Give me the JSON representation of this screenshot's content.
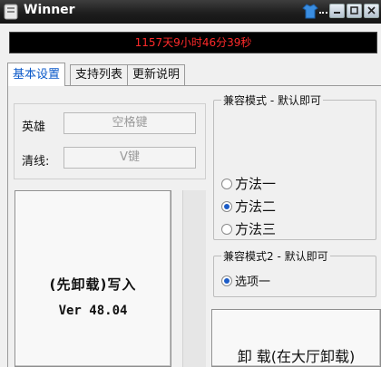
{
  "window": {
    "title": "Winner"
  },
  "timer": {
    "text": "1157天9小时46分39秒",
    "color": "#ff2a2a"
  },
  "tabs": [
    {
      "label": "基本设置",
      "active": true
    },
    {
      "label": "支持列表",
      "active": false
    },
    {
      "label": "更新说明",
      "active": false
    }
  ],
  "hotkeys": {
    "hero_label": "英雄",
    "hero_value": "空格键",
    "clear_label": "清线:",
    "clear_value": "V键"
  },
  "inject_button": {
    "line1": "(先卸载)写入",
    "line2": "Ver 48.04"
  },
  "compat1": {
    "title": "兼容模式 - 默认即可",
    "options": [
      {
        "label": "方法一",
        "selected": false
      },
      {
        "label": "方法二",
        "selected": true
      },
      {
        "label": "方法三",
        "selected": false
      }
    ]
  },
  "compat2": {
    "title": "兼容模式2 - 默认即可",
    "options": [
      {
        "label": "选项一",
        "selected": true
      }
    ]
  },
  "unload_button": {
    "label": "卸 载(在大厅卸载)"
  },
  "colors": {
    "accent": "#0b59c9",
    "radio_selected": "#1c5cc7"
  }
}
